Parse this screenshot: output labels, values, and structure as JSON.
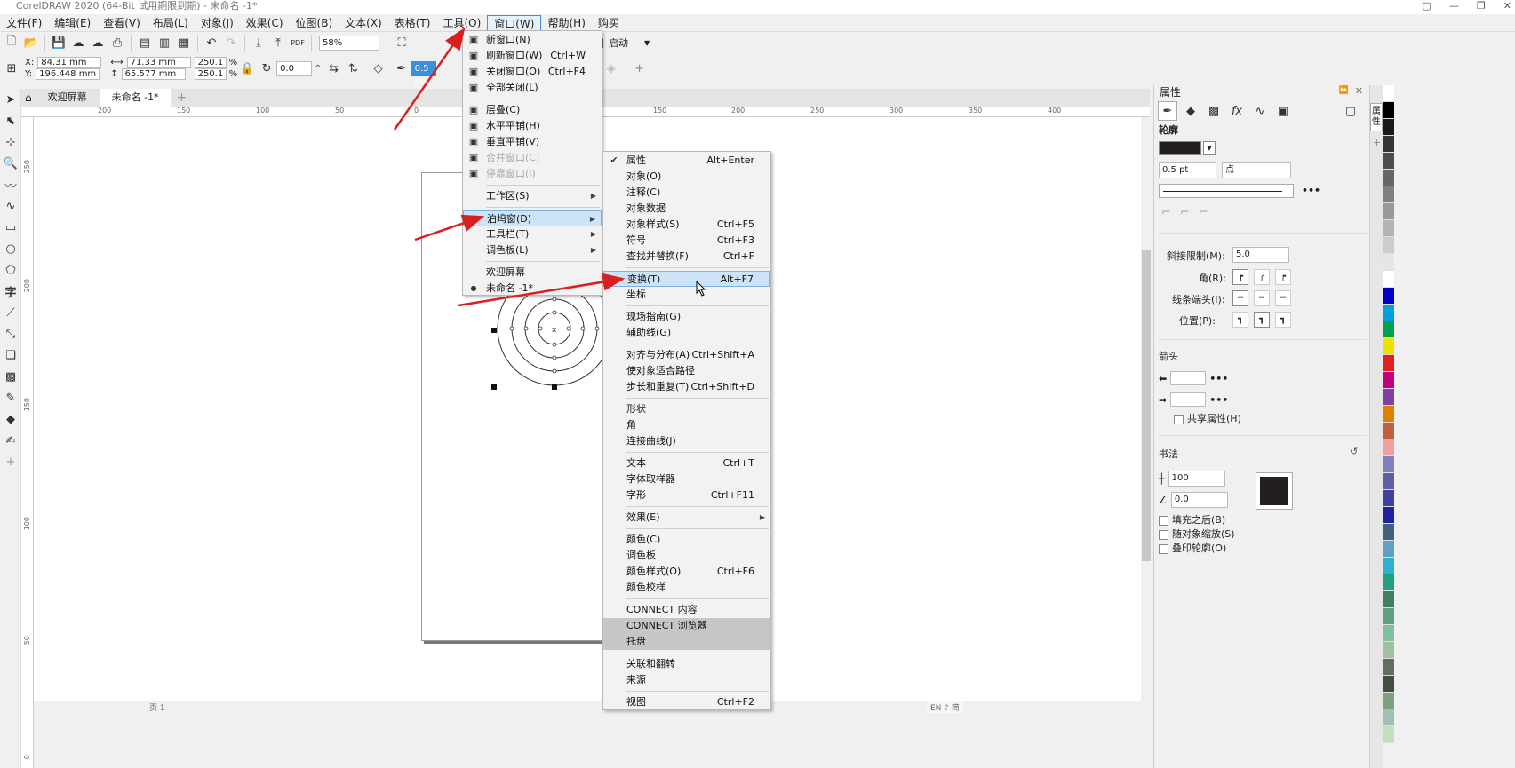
{
  "title_bar": {
    "text": "CorelDRAW 2020 (64-Bit 试用期限到期) - 未命名 -1*"
  },
  "menubar": [
    "文件(F)",
    "编辑(E)",
    "查看(V)",
    "布局(L)",
    "对象(J)",
    "效果(C)",
    "位图(B)",
    "文本(X)",
    "表格(T)",
    "工具(O)",
    "窗口(W)",
    "帮助(H)",
    "购买"
  ],
  "toolbar1": {
    "zoom": "58%",
    "launch": "启动"
  },
  "toolbar2": {
    "x": "84.31 mm",
    "y": "196.448 mm",
    "w": "71.33 mm",
    "h": "65.577 mm",
    "sx": "250.1",
    "sy": "250.1",
    "pct": "%",
    "rot": "0.0",
    "outline": "0.5 pt"
  },
  "doc_tabs": [
    "欢迎屏幕",
    "未命名 -1*"
  ],
  "hruler_ticks": [
    "200",
    "150",
    "100",
    "50",
    "0",
    "150",
    "200",
    "250",
    "300",
    "350",
    "400"
  ],
  "vruler_ticks": [
    "250",
    "200",
    "150",
    "100",
    "50",
    "0"
  ],
  "window_menu": [
    {
      "label": "新窗口(N)",
      "shortcut": "",
      "icon": "new-window-icon"
    },
    {
      "label": "刷新窗口(W)",
      "shortcut": "Ctrl+W",
      "icon": "refresh-window-icon"
    },
    {
      "label": "关闭窗口(O)",
      "shortcut": "Ctrl+F4",
      "icon": "close-window-icon"
    },
    {
      "label": "全部关闭(L)",
      "shortcut": "",
      "icon": "close-all-icon"
    },
    {
      "sep": true
    },
    {
      "label": "层叠(C)",
      "shortcut": "",
      "icon": "cascade-icon"
    },
    {
      "label": "水平平铺(H)",
      "shortcut": "",
      "icon": "tile-horizontal-icon"
    },
    {
      "label": "垂直平铺(V)",
      "shortcut": "",
      "icon": "tile-vertical-icon"
    },
    {
      "label": "合并窗口(C)",
      "shortcut": "",
      "icon": "merge-window-icon",
      "disabled": true
    },
    {
      "label": "停靠窗口(I)",
      "shortcut": "",
      "icon": "dock-window-icon",
      "disabled": true
    },
    {
      "sep": true
    },
    {
      "label": "工作区(S)",
      "sub": true
    },
    {
      "sep": true
    },
    {
      "label": "泊坞窗(D)",
      "sub": true,
      "highlight": true
    },
    {
      "label": "工具栏(T)",
      "sub": true
    },
    {
      "label": "调色板(L)",
      "sub": true
    },
    {
      "sep": true
    },
    {
      "label": "欢迎屏幕"
    },
    {
      "label": "未命名 -1*",
      "bullet": true
    }
  ],
  "docker_menu": [
    {
      "label": "属性",
      "shortcut": "Alt+Enter",
      "check": true
    },
    {
      "label": "对象(O)"
    },
    {
      "label": "注释(C)"
    },
    {
      "label": "对象数据"
    },
    {
      "label": "对象样式(S)",
      "shortcut": "Ctrl+F5"
    },
    {
      "label": "符号",
      "shortcut": "Ctrl+F3"
    },
    {
      "label": "查找并替换(F)",
      "shortcut": "Ctrl+F"
    },
    {
      "sep": true
    },
    {
      "label": "变换(T)",
      "shortcut": "Alt+F7",
      "highlight": true
    },
    {
      "label": "坐标"
    },
    {
      "sep": true
    },
    {
      "label": "现场指南(G)"
    },
    {
      "label": "辅助线(G)"
    },
    {
      "sep": true
    },
    {
      "label": "对齐与分布(A)",
      "shortcut": "Ctrl+Shift+A"
    },
    {
      "label": "使对象适合路径"
    },
    {
      "label": "步长和重复(T)",
      "shortcut": "Ctrl+Shift+D"
    },
    {
      "sep": true
    },
    {
      "label": "形状"
    },
    {
      "label": "角"
    },
    {
      "label": "连接曲线(J)"
    },
    {
      "sep": true
    },
    {
      "label": "文本",
      "shortcut": "Ctrl+T"
    },
    {
      "label": "字体取样器"
    },
    {
      "label": "字形",
      "shortcut": "Ctrl+F11"
    },
    {
      "sep": true
    },
    {
      "label": "效果(E)",
      "sub": true
    },
    {
      "sep": true
    },
    {
      "label": "颜色(C)"
    },
    {
      "label": "调色板"
    },
    {
      "label": "颜色样式(O)",
      "shortcut": "Ctrl+F6"
    },
    {
      "label": "颜色校样"
    },
    {
      "sep": true
    },
    {
      "label": "CONNECT 内容"
    },
    {
      "label": "CONNECT 浏览器",
      "gray": true
    },
    {
      "label": "托盘",
      "gray": true
    },
    {
      "sep": true
    },
    {
      "label": "关联和翻转"
    },
    {
      "label": "来源"
    },
    {
      "sep": true
    },
    {
      "label": "视图",
      "shortcut": "Ctrl+F2"
    }
  ],
  "properties": {
    "title": "属性",
    "outline_title": "轮廓",
    "width": "0.5 pt",
    "unit": "点",
    "miter_label": "斜接限制(M):",
    "miter_value": "5.0",
    "corner_label": "角(R):",
    "cap_label": "线条端头(I):",
    "position_label": "位置(P):",
    "arrow_title": "箭头",
    "share_label": "共享属性(H)",
    "calligraphy_title": "书法",
    "stretch_value": "100",
    "angle_value": "0.0",
    "fill_behind": "填充之后(B)",
    "scale_with": "随对象缩放(S)",
    "overprint": "叠印轮廓(O)"
  },
  "side_tab": "属性",
  "status_ime": "EN ♪ 简",
  "page_indicator": "页 1",
  "colors": {
    "accent": "#3b8fdc",
    "outline_color": "#231f1e",
    "arrow": "#d92020"
  },
  "palette": [
    "#ffffff",
    "#000000",
    "#1a1a1a",
    "#333333",
    "#4d4d4d",
    "#666666",
    "#808080",
    "#999999",
    "#b3b3b3",
    "#cccccc",
    "#e6e6e6",
    "#ffffff",
    "#0000c8",
    "#00a0e0",
    "#00a050",
    "#f0e000",
    "#e02020",
    "#c00080",
    "#8040a0",
    "#e08000",
    "#c06040",
    "#f0a0a0",
    "#8080c0",
    "#6060a0",
    "#4040a0",
    "#2020a0",
    "#406080",
    "#60a0c0",
    "#30b0d0",
    "#20a080",
    "#408060",
    "#60a080",
    "#80c0a0",
    "#a0c0a0",
    "#607060",
    "#405040",
    "#80a080",
    "#a0c0b0",
    "#c0e0c0"
  ]
}
